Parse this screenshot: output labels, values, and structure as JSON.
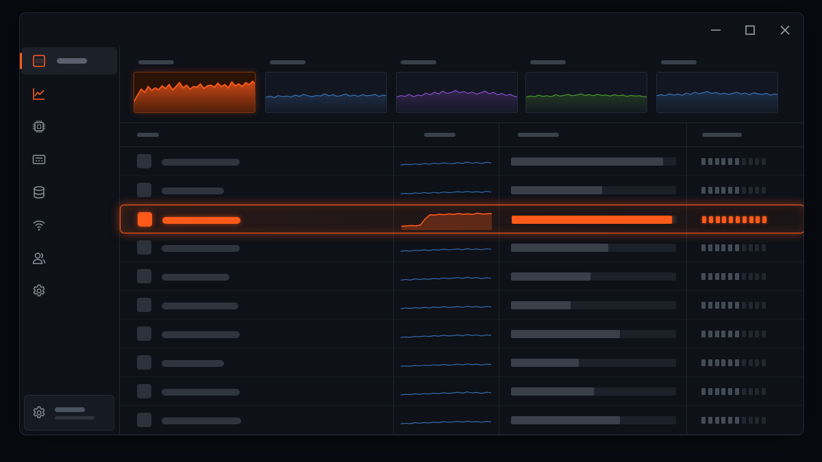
{
  "colors": {
    "accent": "#ff5a1a",
    "blue": "#3b74b8",
    "purple": "#8b4fd0",
    "green": "#4e9a2e"
  },
  "window_controls": [
    "minimize-icon",
    "maximize-icon",
    "close-icon"
  ],
  "sidebar": {
    "items": [
      {
        "icon": "dashboard-icon",
        "active": true
      },
      {
        "icon": "chart-icon",
        "active": false
      },
      {
        "icon": "cpu-icon",
        "active": false
      },
      {
        "icon": "memory-icon",
        "active": false
      },
      {
        "icon": "database-icon",
        "active": false
      },
      {
        "icon": "wifi-icon",
        "active": false
      },
      {
        "icon": "users-icon",
        "active": false
      },
      {
        "icon": "settings-icon",
        "active": false
      }
    ],
    "footer_icon": "settings-icon"
  },
  "cards": [
    {
      "color": "#ff5a1a",
      "selected": true,
      "values": [
        0.25,
        0.45,
        0.62,
        0.52,
        0.7,
        0.58,
        0.66,
        0.6,
        0.72,
        0.64,
        0.76,
        0.6,
        0.7,
        0.82,
        0.66,
        0.74,
        0.62,
        0.7,
        0.68,
        0.78,
        0.64,
        0.72,
        0.74,
        0.68,
        0.8,
        0.7,
        0.76,
        0.66,
        0.84,
        0.72,
        0.78,
        0.7,
        0.82,
        0.76,
        0.86,
        0.74
      ]
    },
    {
      "color": "#3b74b8",
      "selected": false,
      "values": [
        0.35,
        0.4,
        0.33,
        0.45,
        0.38,
        0.42,
        0.36,
        0.48,
        0.4,
        0.52,
        0.44,
        0.38,
        0.46,
        0.42,
        0.56,
        0.44,
        0.5,
        0.4,
        0.46,
        0.54,
        0.42,
        0.48,
        0.4,
        0.5,
        0.44,
        0.46,
        0.52,
        0.4,
        0.48,
        0.44
      ]
    },
    {
      "color": "#8b4fd0",
      "selected": false,
      "values": [
        0.35,
        0.45,
        0.4,
        0.52,
        0.38,
        0.48,
        0.44,
        0.6,
        0.5,
        0.66,
        0.54,
        0.72,
        0.58,
        0.64,
        0.76,
        0.62,
        0.7,
        0.58,
        0.66,
        0.54,
        0.62,
        0.72,
        0.56,
        0.64,
        0.5,
        0.58,
        0.46,
        0.52,
        0.4,
        0.36
      ]
    },
    {
      "color": "#4e9a2e",
      "selected": false,
      "values": [
        0.35,
        0.42,
        0.38,
        0.48,
        0.4,
        0.44,
        0.38,
        0.5,
        0.42,
        0.46,
        0.52,
        0.44,
        0.48,
        0.56,
        0.46,
        0.5,
        0.44,
        0.52,
        0.46,
        0.48,
        0.42,
        0.5,
        0.44,
        0.48,
        0.4,
        0.46,
        0.42,
        0.44,
        0.38,
        0.4
      ]
    },
    {
      "color": "#3b74b8",
      "selected": false,
      "values": [
        0.45,
        0.5,
        0.44,
        0.56,
        0.48,
        0.54,
        0.46,
        0.6,
        0.52,
        0.66,
        0.56,
        0.62,
        0.7,
        0.58,
        0.64,
        0.54,
        0.6,
        0.52,
        0.58,
        0.66,
        0.54,
        0.6,
        0.5,
        0.62,
        0.56,
        0.52,
        0.58,
        0.48,
        0.54,
        0.5
      ]
    }
  ],
  "rows": [
    {
      "name_len": 0.75,
      "util": 0.92,
      "segs": 6,
      "selected": false,
      "spark": [
        0.3,
        0.4,
        0.35,
        0.45,
        0.38,
        0.5,
        0.42,
        0.55,
        0.45,
        0.6,
        0.5,
        0.48,
        0.62,
        0.52,
        0.7,
        0.55,
        0.65,
        0.5,
        0.68,
        0.58
      ]
    },
    {
      "name_len": 0.6,
      "util": 0.55,
      "segs": 6,
      "selected": false,
      "spark": [
        0.3,
        0.35,
        0.3,
        0.42,
        0.36,
        0.45,
        0.38,
        0.5,
        0.4,
        0.55,
        0.46,
        0.5,
        0.58,
        0.5,
        0.62,
        0.52,
        0.6,
        0.48,
        0.64,
        0.55
      ]
    },
    {
      "name_len": 0.75,
      "util": 0.97,
      "segs": 10,
      "selected": true,
      "spark": [
        0.1,
        0.12,
        0.15,
        0.12,
        0.18,
        0.55,
        0.8,
        0.78,
        0.84,
        0.8,
        0.86,
        0.82,
        0.88,
        0.83,
        0.86,
        0.82,
        0.9,
        0.84,
        0.86,
        0.88
      ]
    },
    {
      "name_len": 0.75,
      "util": 0.59,
      "segs": 6,
      "selected": false,
      "spark": [
        0.3,
        0.38,
        0.32,
        0.45,
        0.4,
        0.48,
        0.42,
        0.52,
        0.46,
        0.6,
        0.5,
        0.55,
        0.62,
        0.5,
        0.66,
        0.55,
        0.62,
        0.5,
        0.64,
        0.58
      ]
    },
    {
      "name_len": 0.65,
      "util": 0.48,
      "segs": 6,
      "selected": false,
      "spark": [
        0.3,
        0.36,
        0.3,
        0.44,
        0.38,
        0.46,
        0.4,
        0.52,
        0.44,
        0.58,
        0.5,
        0.54,
        0.64,
        0.52,
        0.68,
        0.56,
        0.62,
        0.5,
        0.6,
        0.55
      ]
    },
    {
      "name_len": 0.74,
      "util": 0.36,
      "segs": 6,
      "selected": false,
      "spark": [
        0.3,
        0.4,
        0.34,
        0.46,
        0.38,
        0.48,
        0.42,
        0.54,
        0.46,
        0.58,
        0.48,
        0.52,
        0.6,
        0.5,
        0.64,
        0.54,
        0.6,
        0.48,
        0.62,
        0.56
      ]
    },
    {
      "name_len": 0.75,
      "util": 0.66,
      "segs": 6,
      "selected": false,
      "spark": [
        0.3,
        0.38,
        0.33,
        0.45,
        0.4,
        0.5,
        0.44,
        0.56,
        0.48,
        0.62,
        0.52,
        0.56,
        0.66,
        0.54,
        0.7,
        0.58,
        0.64,
        0.52,
        0.66,
        0.6
      ]
    },
    {
      "name_len": 0.6,
      "util": 0.41,
      "segs": 6,
      "selected": false,
      "spark": [
        0.3,
        0.35,
        0.3,
        0.42,
        0.36,
        0.45,
        0.4,
        0.5,
        0.44,
        0.54,
        0.46,
        0.5,
        0.58,
        0.48,
        0.62,
        0.52,
        0.58,
        0.46,
        0.6,
        0.54
      ]
    },
    {
      "name_len": 0.75,
      "util": 0.5,
      "segs": 6,
      "selected": false,
      "spark": [
        0.3,
        0.4,
        0.34,
        0.46,
        0.4,
        0.5,
        0.44,
        0.56,
        0.48,
        0.62,
        0.52,
        0.58,
        0.68,
        0.56,
        0.72,
        0.58,
        0.66,
        0.52,
        0.68,
        0.6
      ]
    },
    {
      "name_len": 0.76,
      "util": 0.66,
      "segs": 6,
      "selected": false,
      "spark": [
        0.3,
        0.36,
        0.32,
        0.44,
        0.38,
        0.46,
        0.42,
        0.52,
        0.46,
        0.58,
        0.5,
        0.54,
        0.62,
        0.52,
        0.66,
        0.54,
        0.6,
        0.5,
        0.62,
        0.56
      ]
    }
  ]
}
